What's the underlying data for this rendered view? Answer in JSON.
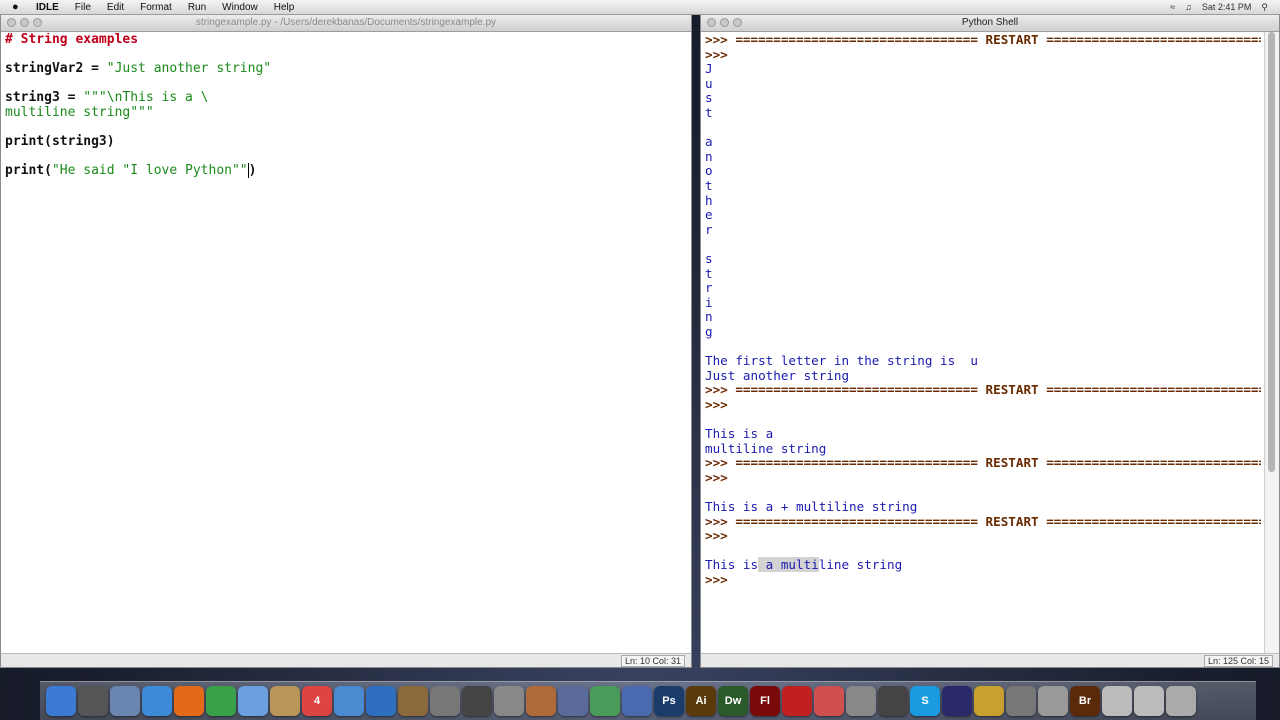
{
  "menubar": {
    "app_name": "IDLE",
    "items": [
      "File",
      "Edit",
      "Format",
      "Run",
      "Window",
      "Help"
    ],
    "right": {
      "clock": "Sat 2:41 PM"
    }
  },
  "editor": {
    "title": "stringexample.py - /Users/derekbanas/Documents/stringexample.py",
    "lines": [
      [
        {
          "t": "# String examples",
          "c": "cm"
        }
      ],
      [],
      [
        {
          "t": "stringVar2 = ",
          "c": "kw"
        },
        {
          "t": "\"Just another string\"",
          "c": "st"
        }
      ],
      [],
      [
        {
          "t": "string3 = ",
          "c": "kw"
        },
        {
          "t": "\"\"\"\\nThis is a \\",
          "c": "st"
        }
      ],
      [
        {
          "t": "multiline string\"\"\"",
          "c": "st"
        }
      ],
      [],
      [
        {
          "t": "print(string3)",
          "c": "kw"
        }
      ],
      [],
      [
        {
          "t": "print(",
          "c": "kw"
        },
        {
          "t": "\"He said \"I love Python\"\"",
          "c": "st"
        },
        {
          "t": ")",
          "c": "kw"
        }
      ]
    ],
    "status": "Ln: 10 Col: 31"
  },
  "shell": {
    "title": "Python Shell",
    "lines": [
      [
        {
          "t": ">>> ================================ RESTART ================================",
          "c": "prompt"
        }
      ],
      [
        {
          "t": ">>> ",
          "c": "prompt"
        }
      ],
      [
        {
          "t": "J",
          "c": "out"
        }
      ],
      [
        {
          "t": "u",
          "c": "out"
        }
      ],
      [
        {
          "t": "s",
          "c": "out"
        }
      ],
      [
        {
          "t": "t",
          "c": "out"
        }
      ],
      [],
      [
        {
          "t": "a",
          "c": "out"
        }
      ],
      [
        {
          "t": "n",
          "c": "out"
        }
      ],
      [
        {
          "t": "o",
          "c": "out"
        }
      ],
      [
        {
          "t": "t",
          "c": "out"
        }
      ],
      [
        {
          "t": "h",
          "c": "out"
        }
      ],
      [
        {
          "t": "e",
          "c": "out"
        }
      ],
      [
        {
          "t": "r",
          "c": "out"
        }
      ],
      [],
      [
        {
          "t": "s",
          "c": "out"
        }
      ],
      [
        {
          "t": "t",
          "c": "out"
        }
      ],
      [
        {
          "t": "r",
          "c": "out"
        }
      ],
      [
        {
          "t": "i",
          "c": "out"
        }
      ],
      [
        {
          "t": "n",
          "c": "out"
        }
      ],
      [
        {
          "t": "g",
          "c": "out"
        }
      ],
      [],
      [
        {
          "t": "The first letter in the string is  u",
          "c": "out"
        }
      ],
      [
        {
          "t": "Just another string",
          "c": "out"
        }
      ],
      [
        {
          "t": ">>> ================================ RESTART ================================",
          "c": "prompt"
        }
      ],
      [
        {
          "t": ">>> ",
          "c": "prompt"
        }
      ],
      [],
      [
        {
          "t": "This is a",
          "c": "out"
        }
      ],
      [
        {
          "t": "multiline string",
          "c": "out"
        }
      ],
      [
        {
          "t": ">>> ================================ RESTART ================================",
          "c": "prompt"
        }
      ],
      [
        {
          "t": ">>> ",
          "c": "prompt"
        }
      ],
      [],
      [
        {
          "t": "This is a + multiline string",
          "c": "out"
        }
      ],
      [
        {
          "t": ">>> ================================ RESTART ================================",
          "c": "prompt"
        }
      ],
      [
        {
          "t": ">>> ",
          "c": "prompt"
        }
      ],
      [],
      [
        {
          "t": "This is",
          "c": "out"
        },
        {
          "t": " a multi",
          "c": "out",
          "hl": true
        },
        {
          "t": "line string",
          "c": "out"
        }
      ],
      [
        {
          "t": ">>> ",
          "c": "prompt"
        }
      ]
    ],
    "status": "Ln: 125 Col: 15"
  },
  "dock": {
    "icons": [
      {
        "name": "finder-icon",
        "label": "",
        "color": "#3b7bd6"
      },
      {
        "name": "dashboard-icon",
        "label": "",
        "color": "#555"
      },
      {
        "name": "preview-icon",
        "label": "",
        "color": "#6a86b0"
      },
      {
        "name": "safari-icon",
        "label": "",
        "color": "#3d8bd8"
      },
      {
        "name": "firefox-icon",
        "label": "",
        "color": "#e46a1a"
      },
      {
        "name": "chrome-icon",
        "label": "",
        "color": "#3aa04a"
      },
      {
        "name": "ichat-icon",
        "label": "",
        "color": "#6aa0e0"
      },
      {
        "name": "address-book-icon",
        "label": "",
        "color": "#b8965a"
      },
      {
        "name": "ical-icon",
        "label": "4",
        "color": "#d44"
      },
      {
        "name": "itunes-icon",
        "label": "",
        "color": "#4a8ad0"
      },
      {
        "name": "ie-icon",
        "label": "",
        "color": "#2f6fc0"
      },
      {
        "name": "photo-icon",
        "label": "",
        "color": "#8a6a3a"
      },
      {
        "name": "automator-icon",
        "label": "",
        "color": "#777"
      },
      {
        "name": "spaces-icon",
        "label": "",
        "color": "#444"
      },
      {
        "name": "system-prefs-icon",
        "label": "",
        "color": "#888"
      },
      {
        "name": "app-icon",
        "label": "",
        "color": "#b06a3a"
      },
      {
        "name": "pen-tool-icon",
        "label": "",
        "color": "#5a6a9a"
      },
      {
        "name": "chart-icon",
        "label": "",
        "color": "#4a9a5a"
      },
      {
        "name": "xcode-icon",
        "label": "",
        "color": "#4a6ab0"
      },
      {
        "name": "photoshop-icon",
        "label": "Ps",
        "color": "#1a3c6a"
      },
      {
        "name": "illustrator-icon",
        "label": "Ai",
        "color": "#5a3a0a"
      },
      {
        "name": "dreamweaver-icon",
        "label": "Dw",
        "color": "#2a5a2a"
      },
      {
        "name": "flash-icon",
        "label": "Fl",
        "color": "#7a0a0a"
      },
      {
        "name": "acrobat-icon",
        "label": "",
        "color": "#c02020"
      },
      {
        "name": "css-edit-icon",
        "label": "",
        "color": "#d05050"
      },
      {
        "name": "gear-app-icon",
        "label": "",
        "color": "#888"
      },
      {
        "name": "clapper-icon",
        "label": "",
        "color": "#444"
      },
      {
        "name": "skype-icon",
        "label": "S",
        "color": "#1a9ae0"
      },
      {
        "name": "eclipse-icon",
        "label": "",
        "color": "#2a2a6a"
      },
      {
        "name": "python-icon",
        "label": "",
        "color": "#c8a030"
      },
      {
        "name": "calculator-icon",
        "label": "",
        "color": "#777"
      },
      {
        "name": "scissors-icon",
        "label": "",
        "color": "#999"
      },
      {
        "name": "bridge-icon",
        "label": "Br",
        "color": "#5a2a0a"
      },
      {
        "name": "documents-icon",
        "label": "",
        "color": "#bbb"
      },
      {
        "name": "downloads-icon",
        "label": "",
        "color": "#bbb"
      },
      {
        "name": "trash-icon",
        "label": "",
        "color": "#aaa"
      }
    ]
  }
}
